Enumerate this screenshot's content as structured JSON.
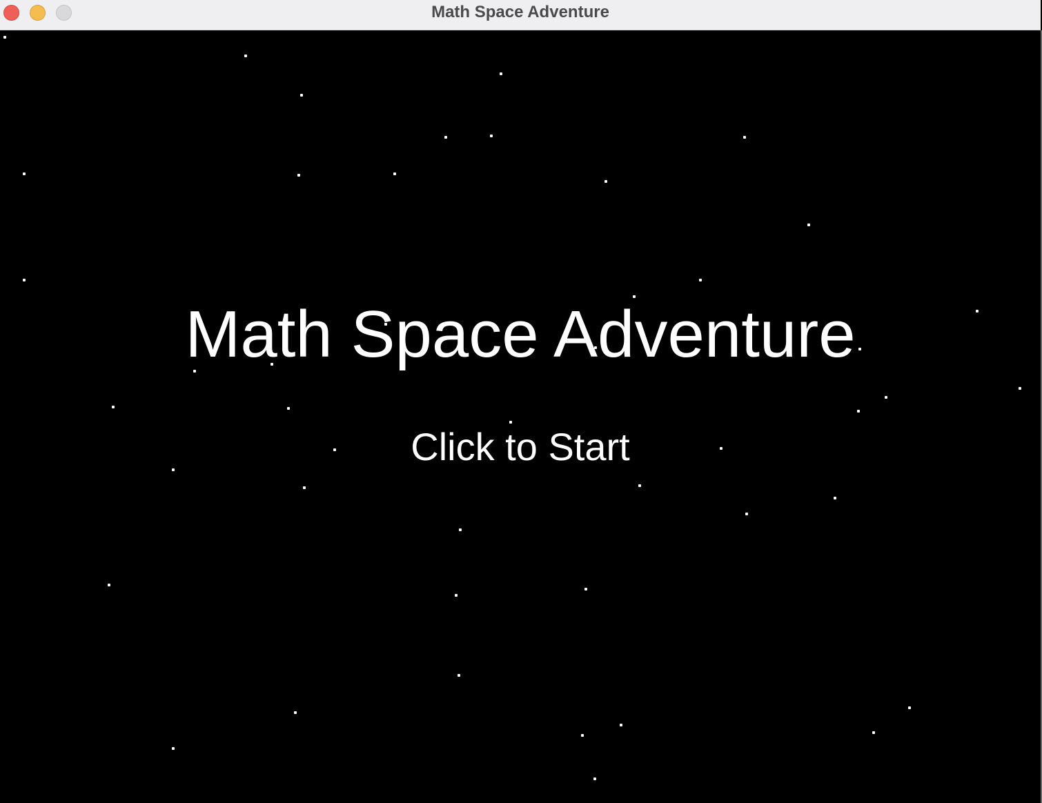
{
  "window": {
    "title": "Math Space Adventure"
  },
  "colors": {
    "close_button": "#ee5f57",
    "minimize_button": "#f5bd4f",
    "zoom_button": "#d9d9db",
    "background": "#000000",
    "text": "#ffffff",
    "star": "#ffffff"
  },
  "screen": {
    "title": "Math Space Adventure",
    "prompt": "Click to Start"
  }
}
